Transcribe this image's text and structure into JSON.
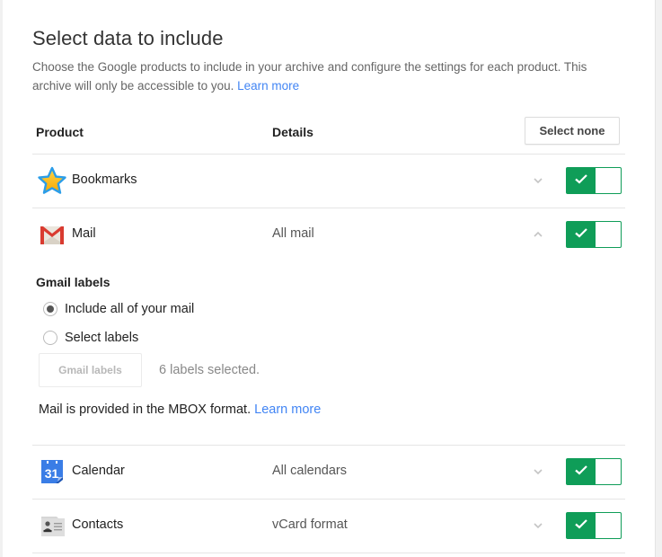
{
  "header": {
    "title": "Select data to include",
    "description": "Choose the Google products to include in your archive and configure the settings for each product. This archive will only be accessible to you.",
    "learn_more": "Learn more"
  },
  "table": {
    "col_product": "Product",
    "col_details": "Details",
    "select_none_label": "Select none"
  },
  "products": [
    {
      "name": "Bookmarks",
      "details": "",
      "icon": "bookmarks-star-icon",
      "expanded": false,
      "enabled": true
    },
    {
      "name": "Mail",
      "details": "All mail",
      "icon": "gmail-icon",
      "expanded": true,
      "enabled": true
    },
    {
      "name": "Calendar",
      "details": "All calendars",
      "icon": "calendar-icon",
      "expanded": false,
      "enabled": true,
      "icon_text": "31"
    },
    {
      "name": "Contacts",
      "details": "vCard format",
      "icon": "contacts-icon",
      "expanded": false,
      "enabled": true
    }
  ],
  "mail_settings": {
    "section_title": "Gmail labels",
    "options": [
      {
        "label": "Include all of your mail",
        "selected": true
      },
      {
        "label": "Select labels",
        "selected": false
      }
    ],
    "gmail_labels_button": "Gmail labels",
    "labels_selected_text": "6 labels selected.",
    "format_note": "Mail is provided in the MBOX format.",
    "learn_more": "Learn more"
  },
  "colors": {
    "accent_green": "#0f9d58",
    "link_blue": "#4285f4"
  }
}
